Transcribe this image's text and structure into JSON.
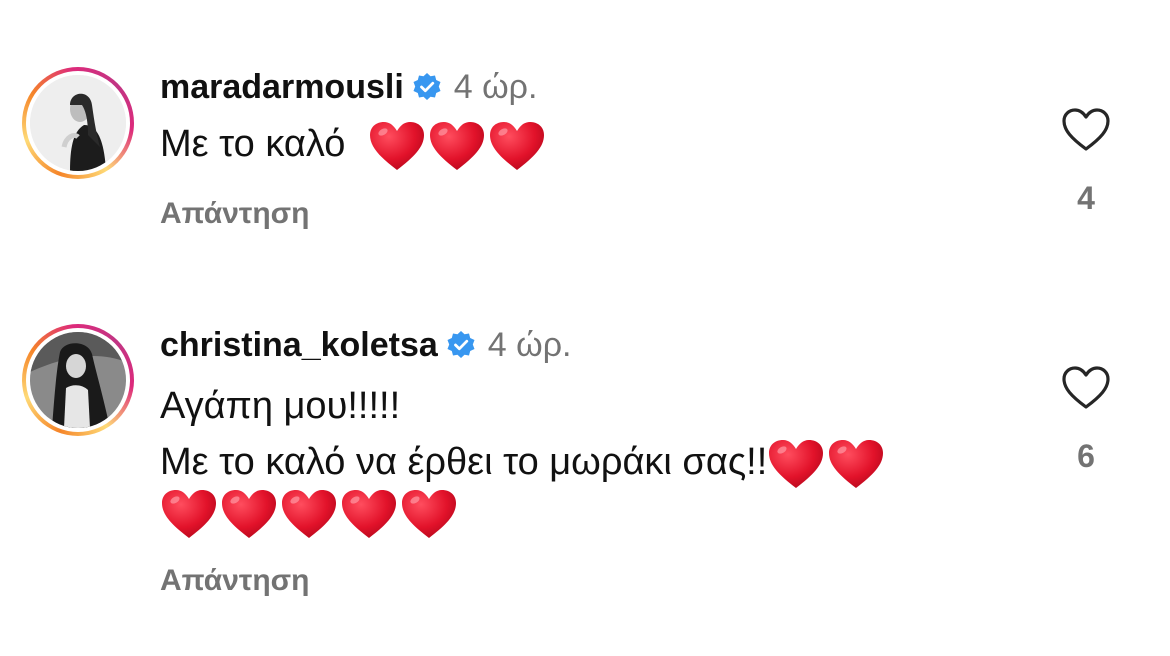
{
  "colors": {
    "verified": "#3897f0",
    "secondary_text": "#737373",
    "heart": "#e2122a"
  },
  "comments": [
    {
      "username": "maradarmousli",
      "verified": true,
      "time": "4 ώρ.",
      "lines": [
        "Με το καλό"
      ],
      "emoji": "❤️❤️❤️",
      "reply_label": "Απάντηση",
      "like_icon": "heart-outline-icon",
      "like_count": "4"
    },
    {
      "username": "christina_koletsa",
      "verified": true,
      "time": "4 ώρ.",
      "lines": [
        "Αγάπη μου!!!!!",
        "Με το καλό να έρθει το μωράκι σας!!"
      ],
      "emoji_line2": "❤️❤️",
      "emoji_line3": "❤️❤️❤️❤️❤️",
      "reply_label": "Απάντηση",
      "like_icon": "heart-outline-icon",
      "like_count": "6"
    }
  ]
}
